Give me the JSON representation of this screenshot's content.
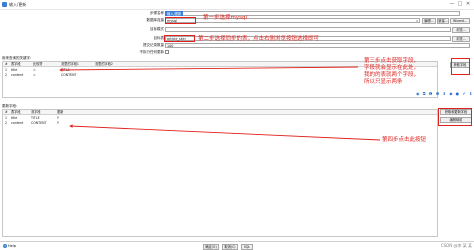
{
  "window": {
    "title": "输入/更新",
    "minimize": "—",
    "maximize": "□",
    "close": "✕"
  },
  "form": {
    "step_name_label": "步骤名称",
    "step_name_value": "输入/更新",
    "db_conn_label": "数据库连接",
    "db_conn_value": "mysql",
    "db_btn_edit": "编辑...",
    "db_btn_new": "新建...",
    "db_btn_wizard": "Wizard...",
    "schema_label": "目标模式",
    "schema_btn": "浏览...",
    "table_label": "目标表",
    "table_value": "article_skin",
    "table_btn": "浏览...",
    "commit_label": "提交记录数量",
    "commit_value": "100",
    "noupdate_label": "不执行任何更新"
  },
  "lookup": {
    "title": "用来查询的关键字:",
    "headers": [
      "#",
      "表字段",
      "比较符",
      "流里的字段1",
      "流里的字段2"
    ],
    "rows": [
      [
        "1",
        "title",
        "=",
        "TITLE",
        ""
      ],
      [
        "2",
        "content",
        "=",
        "CONTENT",
        ""
      ]
    ],
    "get_fields_btn": "获取字段",
    "icons": [
      "◉",
      "⧉",
      "❶",
      "❸",
      "⬇",
      "◆",
      "●",
      "✔",
      "⬇"
    ]
  },
  "update": {
    "title": "更新字段:",
    "headers": [
      "#",
      "表字段",
      "流字段",
      "更新"
    ],
    "rows": [
      [
        "1",
        "title",
        "TITLE",
        "Y"
      ],
      [
        "2",
        "content",
        "CONTENT",
        "Y"
      ]
    ],
    "get_update_btn": "获取和更新字段",
    "edit_mapping_btn": "编辑映射"
  },
  "annotations": {
    "step1": "第一步选择mysql",
    "step2": "第二步选择同步的表，点击右侧浏览按钮选择即可",
    "step3": "第三步点击获取字段，字段就会显示在此处，我的的表就两个字段，所以只显示两条",
    "step4": "第四步点击此按钮"
  },
  "footer": {
    "help": "Help",
    "ok": "确定(O)",
    "cancel": "取消(C)",
    "sql": "SQL",
    "watermark": "CSDN @李 某 某"
  }
}
